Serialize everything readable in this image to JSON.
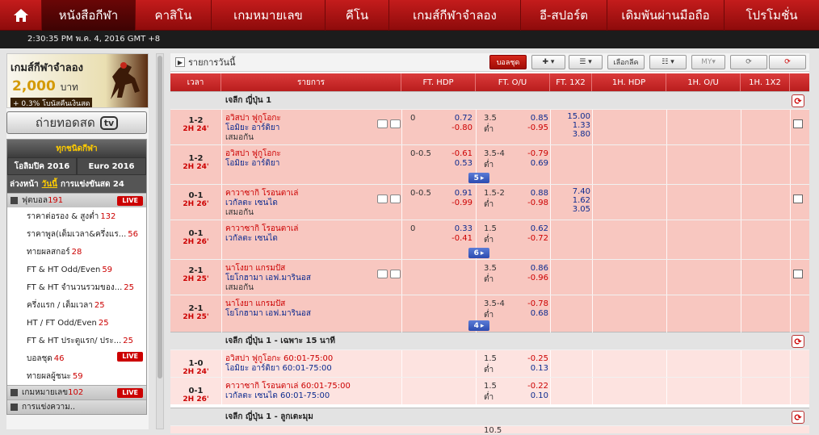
{
  "nav": {
    "items": [
      "หนังสือกีฬา",
      "คาสิโน",
      "เกมหมายเลข",
      "คีโน",
      "เกมส์กีฬาจำลอง",
      "อี-สปอร์ต",
      "เดิมพันผ่านมือถือ",
      "โปรโมชั่น"
    ]
  },
  "clock": "2:30:35 PM พ.ค. 4, 2016 GMT +8",
  "promo": {
    "title": "เกมส์กีฬาจำลอง",
    "amount": "2,000",
    "currency": "บาท",
    "bonus": "+ 0.3% โบนัสคืนเงินสด"
  },
  "live_stream": {
    "label": "ถ่ายทอดสด",
    "icon_text": "tv"
  },
  "sidebar": {
    "all_sports": "ทุกชนิดกีฬา",
    "tabs": [
      "โอลิมปิค 2016",
      "Euro 2016"
    ],
    "subtabs": [
      "ล่วงหน้า",
      "วันนี้",
      "การแข่งขันสด 24"
    ],
    "football": {
      "label": "ฟุตบอล",
      "count": "191",
      "live": "LIVE"
    },
    "markets": [
      {
        "label": "ราคาต่อรอง & สูงต่ำ",
        "count": "132"
      },
      {
        "label": "ราคาพูล(เต็มเวลา&ครึ่งแร...",
        "count": "56"
      },
      {
        "label": "ทายผลสกอร์",
        "count": "28"
      },
      {
        "label": "FT & HT Odd/Even",
        "count": "59"
      },
      {
        "label": "FT & HT จำนวนรวมของ...",
        "count": "25"
      },
      {
        "label": "ครึ่งแรก / เต็มเวลา",
        "count": "25"
      },
      {
        "label": "HT / FT Odd/Even",
        "count": "25"
      },
      {
        "label": "FT & HT ประตูแรก/ ประ...",
        "count": "25"
      },
      {
        "label": "บอลชุด",
        "count": "46",
        "live": "LIVE"
      },
      {
        "label": "ทายผลผู้ชนะ",
        "count": "59"
      }
    ],
    "numbers_game": {
      "label": "เกมหมายเลข",
      "count": "102",
      "live": "LIVE"
    },
    "more": "การแข่งความ.."
  },
  "toolbar": {
    "title": "รายการวันนี้",
    "parlay": "บอลชุด",
    "select": "เลือกลีค",
    "my": "MY"
  },
  "header": [
    "เวลา",
    "รายการ",
    "FT. HDP",
    "FT. O/U",
    "FT. 1X2",
    "1H. HDP",
    "1H. O/U",
    "1H. 1X2"
  ],
  "leagues": [
    "เจลีก ญี่ปุ่น 1",
    "เจลีก ญี่ปุ่น 1 - เฉพาะ 15 นาที",
    "เจลีก ญี่ปุ่น 1 - ลูกเตะมุม"
  ],
  "under_label": "ต่ำ",
  "draw_label": "เสมอกัน",
  "matches": [
    {
      "score": "1-2",
      "time": "2H 24'",
      "home": "อวิสปา ฟูกูโอกะ",
      "away": "โอมิยะ อาร์ดิยา",
      "draw": true,
      "hdp": "0",
      "hdp_h": "0.72",
      "hdp_a": "-0.80",
      "ou": "3.5",
      "ou_o": "0.85",
      "ou_u": "-0.95",
      "x1": "15.00",
      "x2": "1.33",
      "x3": "3.80",
      "more": ""
    },
    {
      "score": "1-2",
      "time": "2H 24'",
      "home": "อวิสปา ฟูกูโอกะ",
      "away": "โอมิยะ อาร์ดิยา",
      "draw": false,
      "hdp": "0-0.5",
      "hdp_h": "-0.61",
      "hdp_a": "0.53",
      "ou": "3.5-4",
      "ou_o": "-0.79",
      "ou_u": "0.69",
      "x1": "",
      "x2": "",
      "x3": "",
      "more": "5"
    },
    {
      "score": "0-1",
      "time": "2H 26'",
      "home": "คาวาซากิ โรอนตาเล่",
      "away": "เวกัลตะ เซนได",
      "draw": true,
      "hdp": "0-0.5",
      "hdp_h": "0.91",
      "hdp_a": "-0.99",
      "ou": "1.5-2",
      "ou_o": "0.88",
      "ou_u": "-0.98",
      "x1": "7.40",
      "x2": "1.62",
      "x3": "3.05",
      "more": ""
    },
    {
      "score": "0-1",
      "time": "2H 26'",
      "home": "คาวาซากิ โรอนตาเล่",
      "away": "เวกัลตะ เซนได",
      "draw": false,
      "hdp": "0",
      "hdp_h": "0.33",
      "hdp_a": "-0.41",
      "ou": "1.5",
      "ou_o": "0.62",
      "ou_u": "-0.72",
      "x1": "",
      "x2": "",
      "x3": "",
      "more": "6"
    },
    {
      "score": "2-1",
      "time": "2H 25'",
      "home": "นาโงยา แกรมปัส",
      "away": "โยโกฮามา เอฟ.มารินอส",
      "draw": true,
      "hdp": "",
      "hdp_h": "",
      "hdp_a": "",
      "ou": "3.5",
      "ou_o": "0.86",
      "ou_u": "-0.96",
      "x1": "",
      "x2": "",
      "x3": "",
      "more": ""
    },
    {
      "score": "2-1",
      "time": "2H 25'",
      "home": "นาโงยา แกรมปัส",
      "away": "โยโกฮามา เอฟ.มารินอส",
      "draw": false,
      "hdp": "",
      "hdp_h": "",
      "hdp_a": "",
      "ou": "3.5-4",
      "ou_o": "-0.78",
      "ou_u": "0.68",
      "x1": "",
      "x2": "",
      "x3": "",
      "more": "4"
    },
    {
      "score": "1-0",
      "time": "2H 24'",
      "home": "อวิสปา ฟูกูโอกะ 60:01-75:00",
      "away": "โอมิยะ อาร์ดิยา 60:01-75:00",
      "draw": false,
      "hdp": "",
      "hdp_h": "",
      "hdp_a": "",
      "ou": "1.5",
      "ou_o": "-0.25",
      "ou_u": "0.13",
      "x1": "",
      "x2": "",
      "x3": "",
      "more": ""
    },
    {
      "score": "0-1",
      "time": "2H 26'",
      "home": "คาวาซากิ โรอนตาเล่ 60:01-75:00",
      "away": "เวกัลตะ เซนได 60:01-75:00",
      "draw": false,
      "hdp": "",
      "hdp_h": "",
      "hdp_a": "",
      "ou": "1.5",
      "ou_o": "-0.22",
      "ou_u": "0.10",
      "x1": "",
      "x2": "",
      "x3": "",
      "more": ""
    }
  ],
  "partial_next": "10.5",
  "colors": {
    "brand": "#b91d1d",
    "row": "#f8c7c0",
    "negative": "#cc0000",
    "positive": "#0d2b8f"
  }
}
